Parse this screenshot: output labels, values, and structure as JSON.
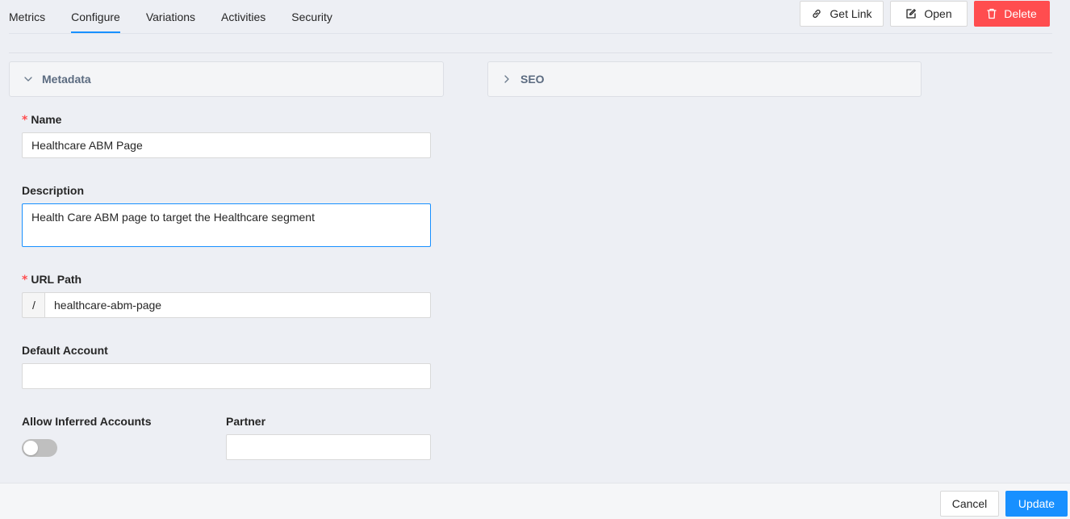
{
  "tabs": [
    {
      "label": "Metrics"
    },
    {
      "label": "Configure"
    },
    {
      "label": "Variations"
    },
    {
      "label": "Activities"
    },
    {
      "label": "Security"
    }
  ],
  "active_tab": "Configure",
  "toolbar": {
    "get_link": {
      "label": "Get Link",
      "icon": "link-icon"
    },
    "open": {
      "label": "Open",
      "icon": "edit-icon"
    },
    "delete": {
      "label": "Delete",
      "icon": "trash-icon"
    }
  },
  "panels": {
    "metadata": {
      "title": "Metadata",
      "expanded": true
    },
    "seo": {
      "title": "SEO",
      "expanded": false
    }
  },
  "form": {
    "required_mark": "*",
    "name": {
      "label": "Name",
      "value": "Healthcare ABM Page"
    },
    "description": {
      "label": "Description",
      "value": "Health Care ABM page to target the Healthcare segment"
    },
    "url_path": {
      "label": "URL Path",
      "prefix": "/",
      "value": "healthcare-abm-page"
    },
    "default_account": {
      "label": "Default Account",
      "value": ""
    },
    "allow_inferred_accounts": {
      "label": "Allow Inferred Accounts",
      "enabled": false
    },
    "partner": {
      "label": "Partner",
      "value": ""
    }
  },
  "footer": {
    "cancel_label": "Cancel",
    "update_label": "Update"
  },
  "colors": {
    "accent": "#1890ff",
    "danger": "#ff4d4f",
    "background": "#edeff4"
  }
}
